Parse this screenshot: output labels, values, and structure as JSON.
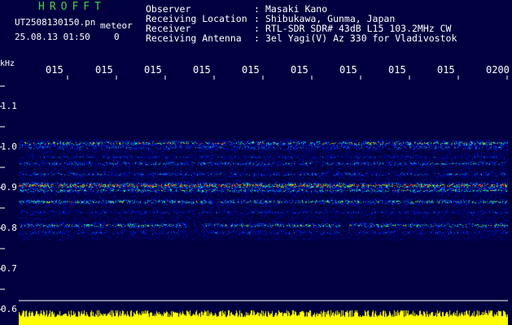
{
  "header": {
    "app_title": "HROFFT",
    "file_name": "UT2508130150.pn",
    "meteor_label": "meteor",
    "datetime": "25.08.13 01:50",
    "count": "0"
  },
  "info": {
    "observer_key": "Observer",
    "observer_val": "Masaki Kano",
    "location_key": "Receiving Location",
    "location_val": "Shibukawa, Gunma, Japan",
    "receiver_key": "Receiver",
    "receiver_val": "RTL-SDR SDR# 43dB L15 103.2MHz CW",
    "antenna_key": "Receiving Antenna",
    "antenna_val": "3el Yagi(V) Az 330 for Vladivostok",
    "colon": ":"
  },
  "axis": {
    "unit": "kHz",
    "y_labels": [
      "1.1",
      "1.0",
      "0.9",
      "0.8",
      "0.7",
      "0.6"
    ],
    "x_labels": [
      "015",
      "015",
      "015",
      "015",
      "015",
      "015",
      "015",
      "015",
      "015",
      "0200"
    ]
  },
  "colors": {
    "background": "#000040",
    "info_text": "#ffffff",
    "title_text": "#49d049",
    "spectrum_fill": "#ffff00",
    "grid_tick": "#ffffff"
  }
}
